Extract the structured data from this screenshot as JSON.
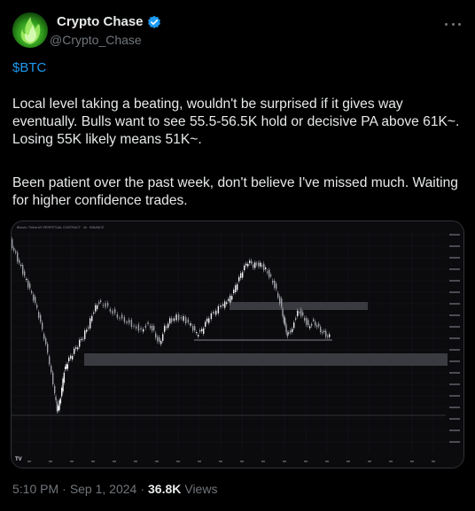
{
  "tweet": {
    "author": {
      "display_name": "Crypto Chase",
      "handle": "@Crypto_Chase",
      "verified": true
    },
    "cashtag": "$BTC",
    "paragraphs": [
      "Local level taking a beating, wouldn't be surprised if it gives way eventually. Bulls want to see 55.5-56.5K hold or decisive PA above 61K~. Losing 55K likely means 51K~.",
      "Been patient over the past week, don't believe I've missed much. Waiting for higher confidence trades."
    ],
    "time": "5:10 PM",
    "date": "Sep 1, 2024",
    "views_count": "36.8K",
    "views_label": "Views",
    "separator": "·"
  },
  "chart_header": "Bitcoin / TetherUS PERPETUAL CONTRACT · 4h · BINANCE",
  "colors": {
    "accent": "#1d9bf0",
    "bg": "#000000",
    "zone": "#3a3b40"
  },
  "icons": {
    "verified": "verified-badge-icon",
    "more": "more-dots-icon",
    "tv_logo": "tradingview-logo-icon"
  }
}
